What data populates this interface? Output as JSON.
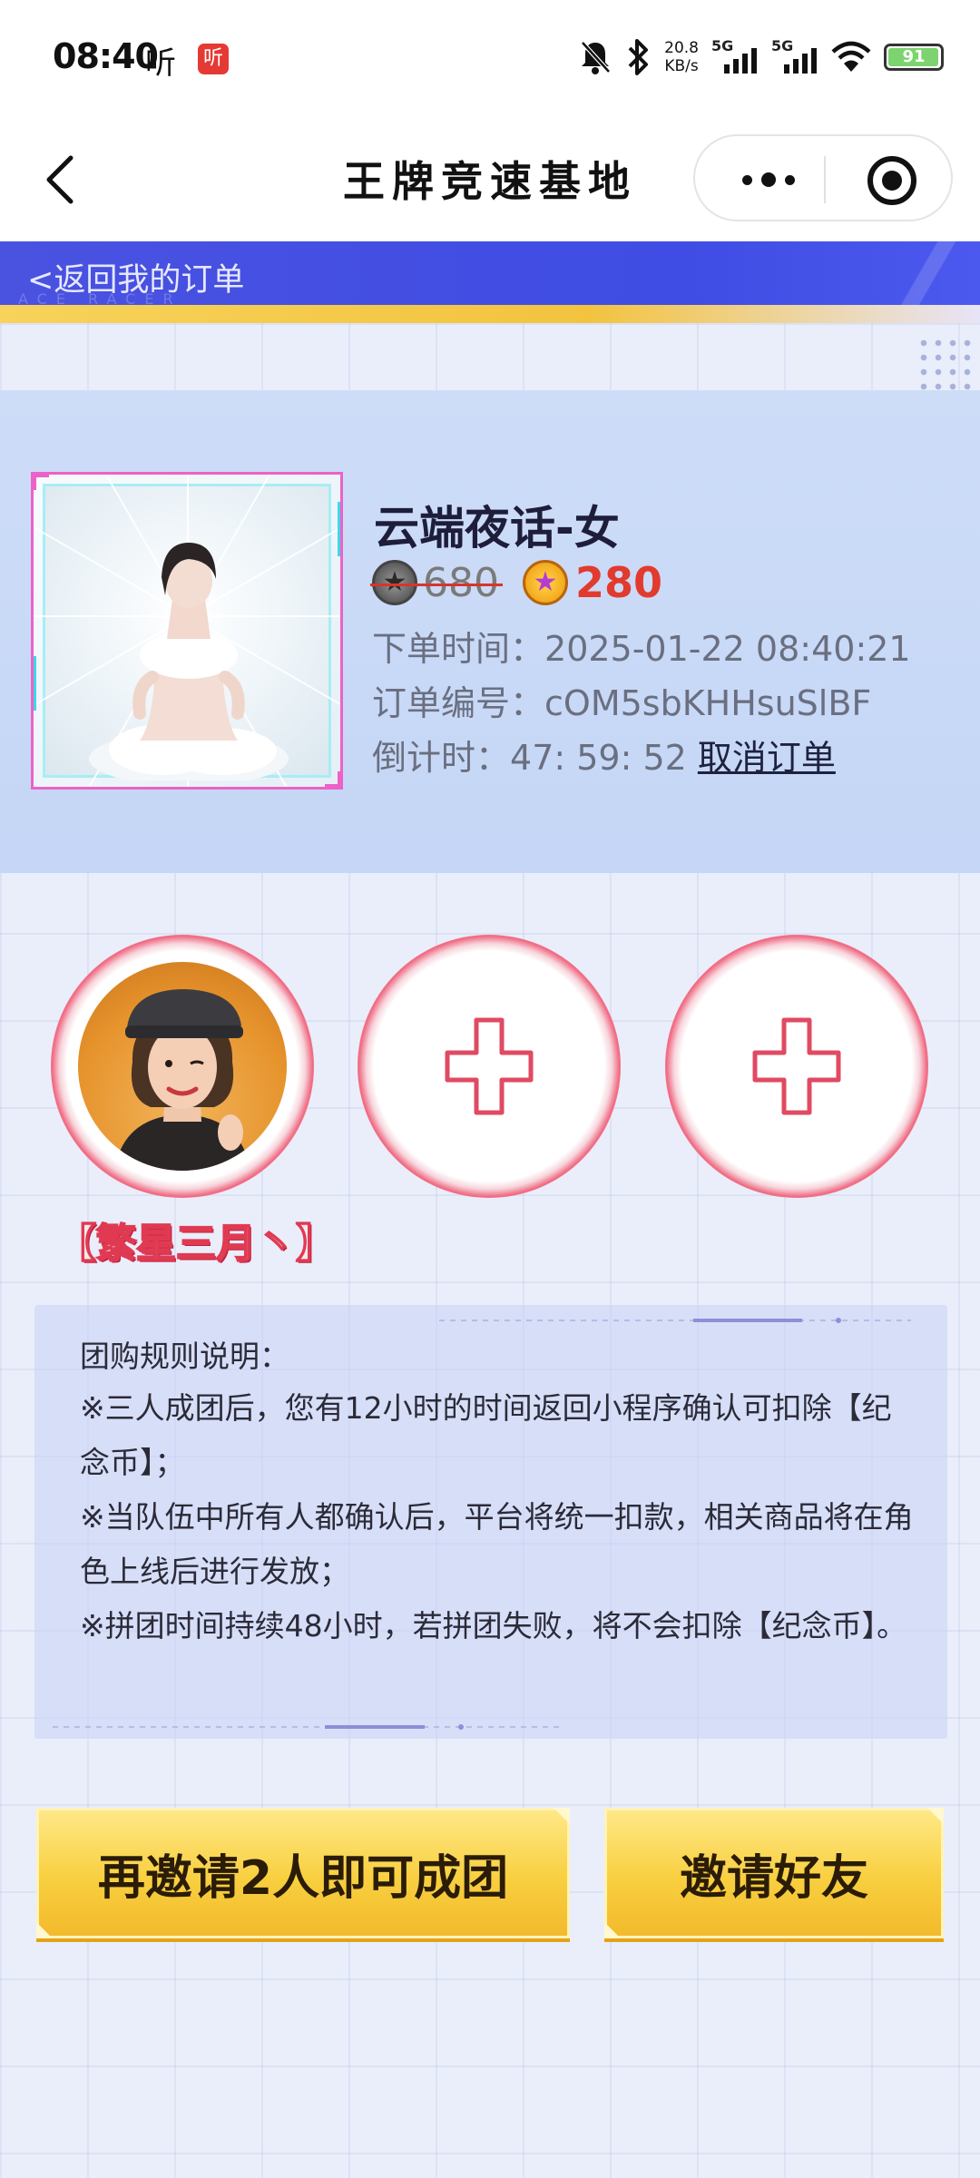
{
  "status_bar": {
    "time": "08:40",
    "listen_app": "听",
    "badge_app": "听",
    "net_speed_value": "20.8",
    "net_speed_unit": "KB/s",
    "signal1_label": "5G",
    "signal2_label": "5G",
    "battery_level": "91",
    "battery_fraction": 0.91
  },
  "nav": {
    "title": "王牌竞速基地"
  },
  "banner": {
    "back_link": "<返回我的订单",
    "watermark": "ACE RACER"
  },
  "product": {
    "name": "云端夜话-女",
    "original_price": "680",
    "price": "280",
    "order_time_label": "下单时间：",
    "order_time": "2025-01-22 08:40:21",
    "order_no_label": "订单编号：",
    "order_no": "cOM5sbKHHsuSlBF",
    "countdown_label": "倒计时：",
    "countdown": "47: 59: 52",
    "cancel_label": "取消订单"
  },
  "members": {
    "leader_name": "【繁星三月丶】"
  },
  "rules": {
    "title": "团购规则说明：",
    "p1": "※三人成团后，您有12小时的时间返回小程序确认可扣除【纪念币】；",
    "p2": "※当队伍中所有人都确认后，平台将统一扣款，相关商品将在角色上线后进行发放；",
    "p3": "※拼团时间持续48小时，若拼团失败，将不会扣除【纪念币】。"
  },
  "buttons": {
    "group_label": "再邀请2人即可成团",
    "invite_label": "邀请好友"
  },
  "colors": {
    "banner_blue": "#4a52e0",
    "price_red": "#e23a2e",
    "button_gold": "#f8cf3f",
    "ring_pink": "#f06a82"
  }
}
